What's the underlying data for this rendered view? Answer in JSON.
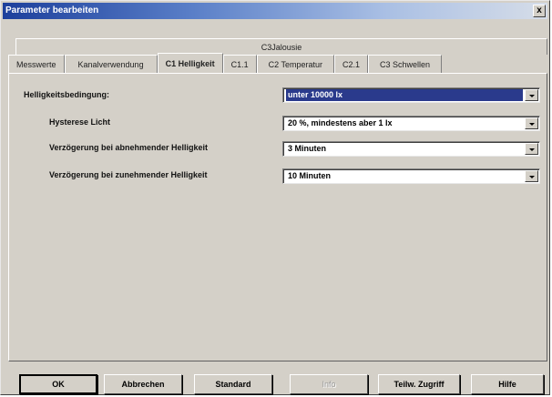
{
  "window": {
    "title": "Parameter bearbeiten",
    "close_label": "x"
  },
  "tabs": {
    "upper": "C3Jalousie",
    "items": [
      {
        "label": "Messwerte"
      },
      {
        "label": "Kanalverwendung"
      },
      {
        "label": "C1 Helligkeit",
        "active": true
      },
      {
        "label": "C1.1"
      },
      {
        "label": "C2 Temperatur"
      },
      {
        "label": "C2.1"
      },
      {
        "label": "C3 Schwellen"
      }
    ]
  },
  "params": [
    {
      "label": "Helligkeitsbedingung:",
      "value": "unter 10000 lx",
      "selected": true
    },
    {
      "label": "Hysterese Licht",
      "value": "20 %, mindestens aber 1 lx"
    },
    {
      "label": "Verzögerung bei abnehmender Helligkeit",
      "value": "3 Minuten"
    },
    {
      "label": "Verzögerung bei zunehmender Helligkeit",
      "value": "10 Minuten"
    }
  ],
  "buttons": {
    "ok": "OK",
    "cancel": "Abbrechen",
    "standard": "Standard",
    "info": "Info",
    "partial_access": "Teilw. Zugriff",
    "help": "Hilfe"
  },
  "colors": {
    "title_start": "#1c3f9c",
    "selection": "#2a3a8c",
    "face": "#d4d0c8"
  }
}
